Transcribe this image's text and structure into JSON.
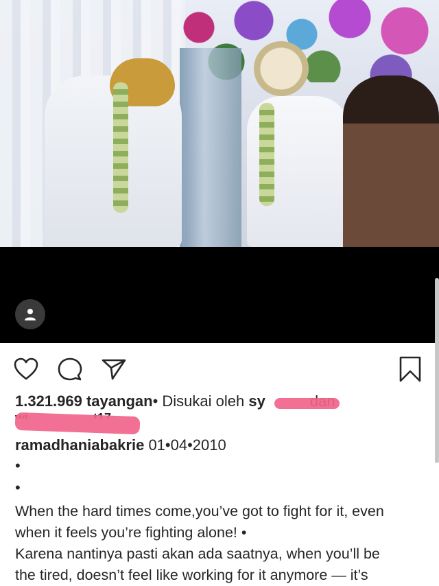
{
  "post": {
    "views_count": "1.321.969 tayangan",
    "liked_by_prefix": "• Disukai oleh ",
    "liked_by_user_partial": "sy",
    "liked_by_suffix": "dan",
    "second_line_fragment": "wi",
    "second_line_tail": "t17",
    "username": "ramadhaniabakrie",
    "date": "01•04•2010",
    "bullet": "•",
    "caption_line_1": "When the hard times come,you’ve got to fight for it, even",
    "caption_line_2": "when it feels you’re fighting alone! •",
    "caption_line_3": "Karena nantinya pasti akan ada saatnya, when you’ll be",
    "caption_line_4": "the tired, doesn’t feel like working for it anymore — it’s"
  },
  "actions": {
    "like_icon": "heart-icon",
    "comment_icon": "comment-icon",
    "share_icon": "send-icon",
    "save_icon": "bookmark-icon"
  },
  "video": {
    "user_tag_icon": "person-icon"
  },
  "colors": {
    "redaction": "#f0648a",
    "text": "#262626",
    "background": "#ffffff"
  }
}
